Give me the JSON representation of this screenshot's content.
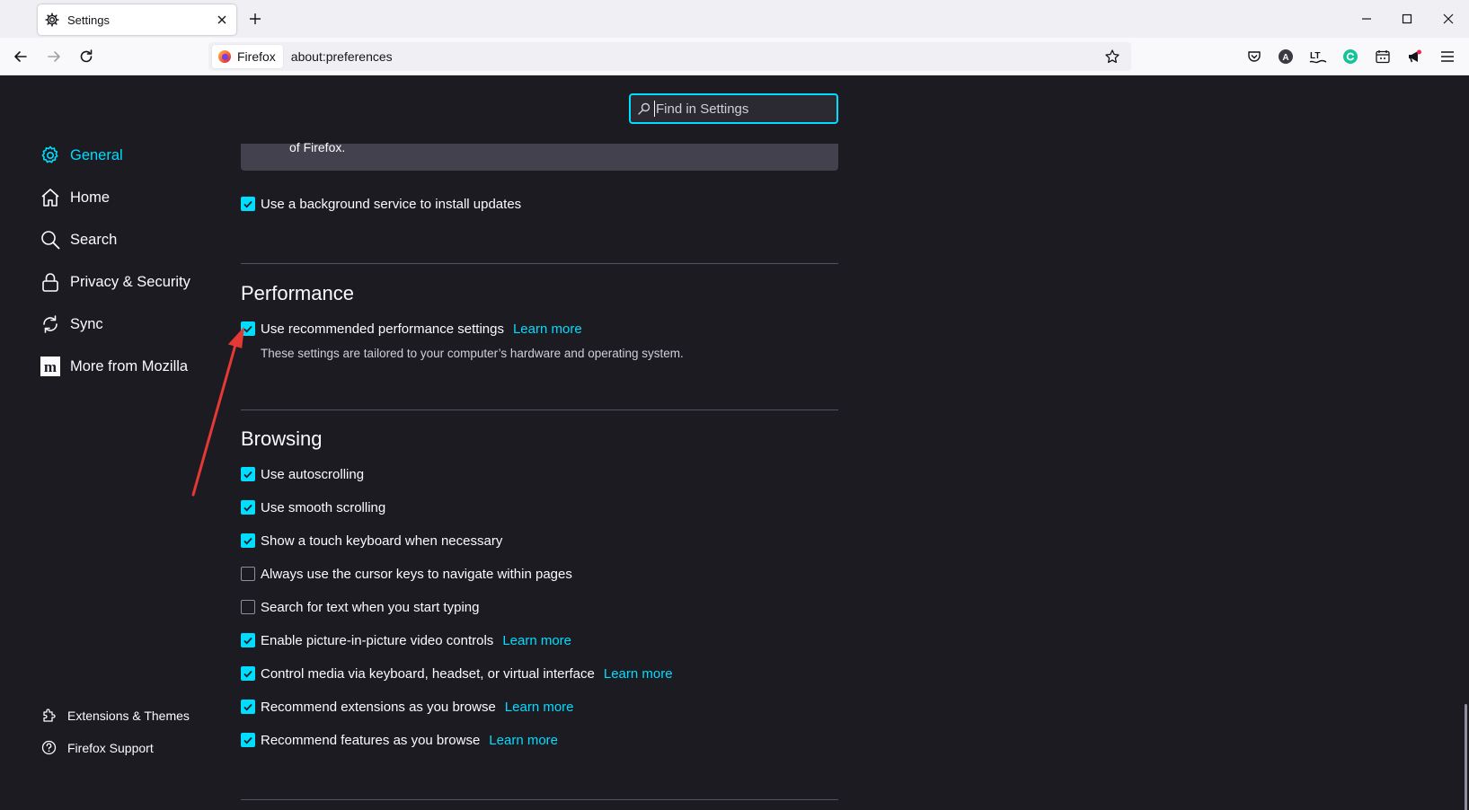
{
  "tab": {
    "title": "Settings"
  },
  "urlbar": {
    "identity": "Firefox",
    "url": "about:preferences"
  },
  "search": {
    "placeholder": "Find in Settings"
  },
  "sidebar": {
    "items": [
      {
        "label": "General",
        "icon": "gear-icon",
        "active": true
      },
      {
        "label": "Home",
        "icon": "home-icon"
      },
      {
        "label": "Search",
        "icon": "search-icon"
      },
      {
        "label": "Privacy & Security",
        "icon": "lock-icon"
      },
      {
        "label": "Sync",
        "icon": "sync-icon"
      },
      {
        "label": "More from Mozilla",
        "icon": "mozilla-icon"
      }
    ],
    "footer": [
      {
        "label": "Extensions & Themes",
        "icon": "puzzle-icon"
      },
      {
        "label": "Firefox Support",
        "icon": "help-icon"
      }
    ]
  },
  "updates": {
    "notice_tail": "of Firefox.",
    "background_service": {
      "label": "Use a background service to install updates",
      "checked": true
    }
  },
  "performance": {
    "heading": "Performance",
    "recommended": {
      "label": "Use recommended performance settings",
      "checked": true,
      "link": "Learn more"
    },
    "description": "These settings are tailored to your computer’s hardware and operating system."
  },
  "browsing": {
    "heading": "Browsing",
    "options": [
      {
        "label": "Use autoscrolling",
        "checked": true
      },
      {
        "label": "Use smooth scrolling",
        "checked": true
      },
      {
        "label": "Show a touch keyboard when necessary",
        "checked": true
      },
      {
        "label": "Always use the cursor keys to navigate within pages",
        "checked": false
      },
      {
        "label": "Search for text when you start typing",
        "checked": false
      },
      {
        "label": "Enable picture-in-picture video controls",
        "checked": true,
        "link": "Learn more"
      },
      {
        "label": "Control media via keyboard, headset, or virtual interface",
        "checked": true,
        "link": "Learn more"
      },
      {
        "label": "Recommend extensions as you browse",
        "checked": true,
        "link": "Learn more"
      },
      {
        "label": "Recommend features as you browse",
        "checked": true,
        "link": "Learn more"
      }
    ]
  },
  "colors": {
    "accent": "#00ddff",
    "background": "#1c1b22",
    "annotation_arrow": "#e53935"
  }
}
